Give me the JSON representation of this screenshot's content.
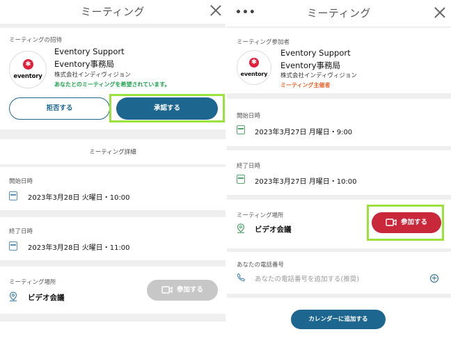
{
  "left": {
    "header": {
      "title": "ミーティング"
    },
    "invite": {
      "section_label": "ミーティングの招待",
      "logo_text": "eventory",
      "name": "Eventory Support",
      "org_name": "Eventory事務局",
      "company": "株式会社インディヴィジョン",
      "status": "あなたとのミーティングを希望されています。"
    },
    "buttons": {
      "decline": "拒否する",
      "accept": "承認する"
    },
    "details_header": "ミーティング詳細",
    "start": {
      "label": "開始日時",
      "value": "2023年3月28日 火曜日・10:00"
    },
    "end": {
      "label": "終了日時",
      "value": "2023年3月28日 火曜日・11:00"
    },
    "location": {
      "label": "ミーティング場所",
      "value": "ビデオ会議",
      "join_label": "参加する"
    }
  },
  "right": {
    "header": {
      "title": "ミーティング",
      "menu": "•••"
    },
    "participant": {
      "section_label": "ミーティング参加者",
      "logo_text": "eventory",
      "name": "Eventory Support",
      "org_name": "Eventory事務局",
      "company": "株式会社インディヴィジョン",
      "role": "ミーティング主催者"
    },
    "start": {
      "label": "開始日時",
      "value": "2023年3月27日 月曜日・9:00"
    },
    "end": {
      "label": "終了日時",
      "value": "2023年3月27日 月曜日・10:00"
    },
    "location": {
      "label": "ミーティング場所",
      "value": "ビデオ会議",
      "join_label": "参加する"
    },
    "phone": {
      "label": "あなたの電話番号",
      "placeholder": "あなたの電話番号を追加する(推奨)"
    },
    "calendar_button": "カレンダーに追加する"
  },
  "colors": {
    "primary": "#1c6690",
    "join_red": "#c9283b",
    "highlight": "#9be23c",
    "status_green": "#1aa24a",
    "host_orange": "#e8622a"
  }
}
